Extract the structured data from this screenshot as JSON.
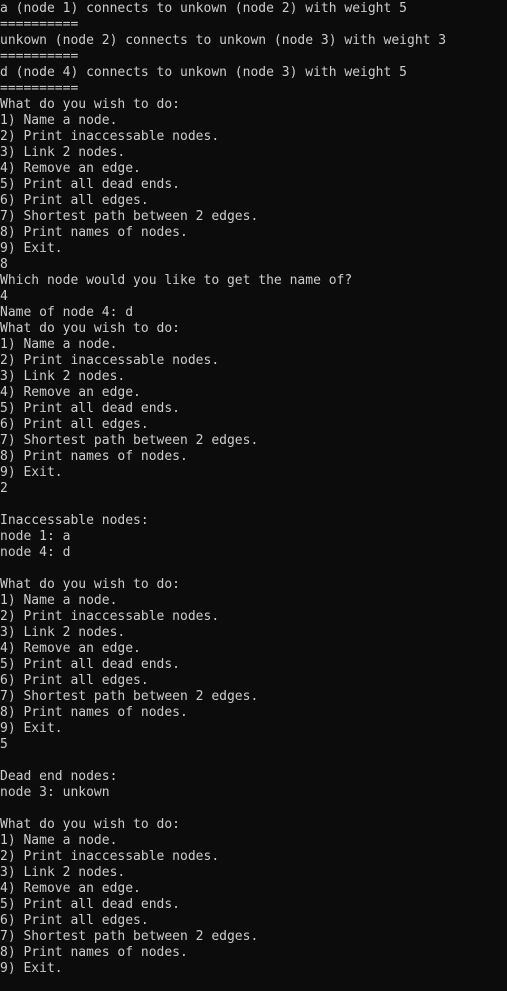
{
  "terminal": {
    "background": "#0c0c0c",
    "foreground": "#cccccc",
    "lines": [
      "a (node 1) connects to unkown (node 2) with weight 5",
      "==========",
      "unkown (node 2) connects to unkown (node 3) with weight 3",
      "==========",
      "d (node 4) connects to unkown (node 3) with weight 5",
      "==========",
      "What do you wish to do:",
      "1) Name a node.",
      "2) Print inaccessable nodes.",
      "3) Link 2 nodes.",
      "4) Remove an edge.",
      "5) Print all dead ends.",
      "6) Print all edges.",
      "7) Shortest path between 2 edges.",
      "8) Print names of nodes.",
      "9) Exit.",
      "8",
      "Which node would you like to get the name of?",
      "4",
      "Name of node 4: d",
      "What do you wish to do:",
      "1) Name a node.",
      "2) Print inaccessable nodes.",
      "3) Link 2 nodes.",
      "4) Remove an edge.",
      "5) Print all dead ends.",
      "6) Print all edges.",
      "7) Shortest path between 2 edges.",
      "8) Print names of nodes.",
      "9) Exit.",
      "2",
      "",
      "Inaccessable nodes:",
      "node 1: a",
      "node 4: d",
      "",
      "What do you wish to do:",
      "1) Name a node.",
      "2) Print inaccessable nodes.",
      "3) Link 2 nodes.",
      "4) Remove an edge.",
      "5) Print all dead ends.",
      "6) Print all edges.",
      "7) Shortest path between 2 edges.",
      "8) Print names of nodes.",
      "9) Exit.",
      "5",
      "",
      "Dead end nodes:",
      "node 3: unkown",
      "",
      "What do you wish to do:",
      "1) Name a node.",
      "2) Print inaccessable nodes.",
      "3) Link 2 nodes.",
      "4) Remove an edge.",
      "5) Print all dead ends.",
      "6) Print all edges.",
      "7) Shortest path between 2 edges.",
      "8) Print names of nodes.",
      "9) Exit."
    ]
  }
}
